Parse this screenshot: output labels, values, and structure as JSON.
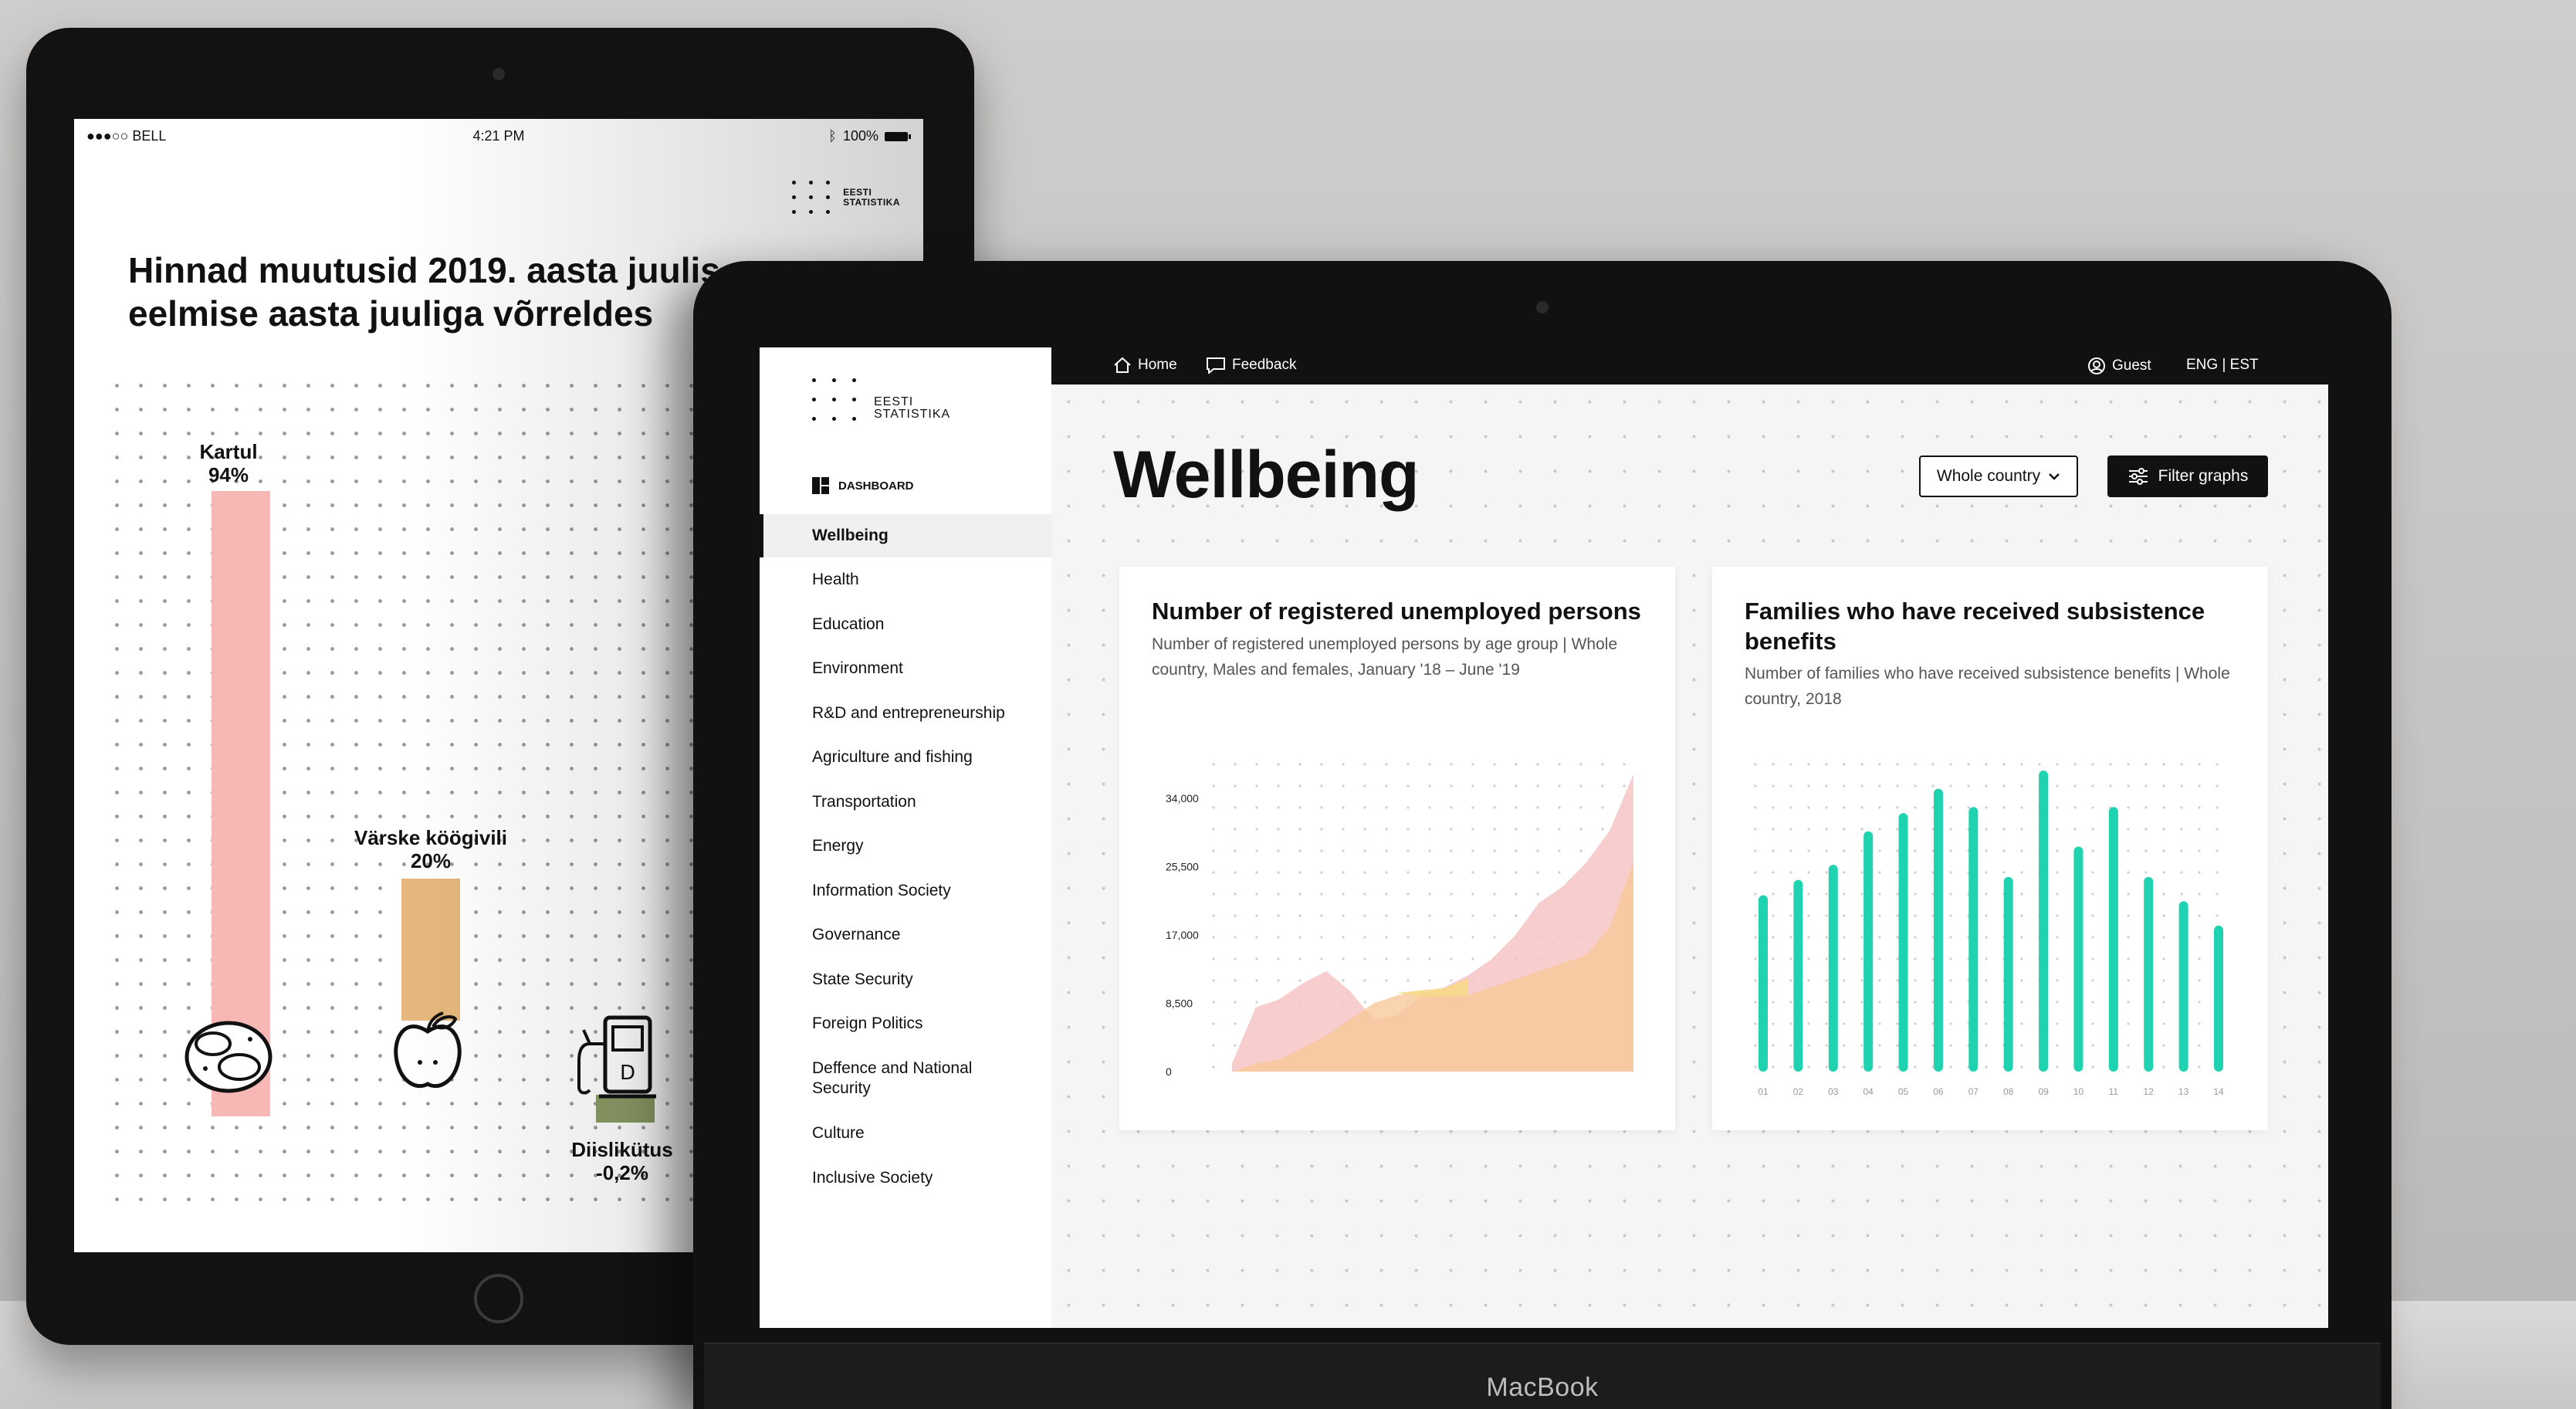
{
  "tablet": {
    "status": {
      "carrier": "●●●○○ BELL",
      "time": "4:21 PM",
      "battery": "100%"
    },
    "logo": {
      "line1": "EESTI",
      "line2": "STATISTIKA"
    },
    "title": "Hinnad muutusid 2019. aasta juulis eelmise aasta juuliga võrreldes",
    "bars": [
      {
        "name": "Kartul",
        "value_label": "94%",
        "value": 94,
        "color": "#f7b7b5",
        "icon": "potato-icon"
      },
      {
        "name": "Värske köögivili",
        "value_label": "20%",
        "value": 20,
        "color": "#e6b87d",
        "icon": "apple-icon"
      },
      {
        "name": "Diislikütus",
        "value_label": "-0,2%",
        "value": -0.2,
        "color": "#8a9a64",
        "icon": "fuel-pump-icon"
      }
    ]
  },
  "laptop": {
    "brand": "MacBook",
    "topbar": {
      "home": "Home",
      "feedback": "Feedback",
      "guest": "Guest",
      "lang": "ENG | EST"
    },
    "logo": {
      "line1": "EESTI",
      "line2": "STATISTIKA"
    },
    "dashboard_label": "DASHBOARD",
    "nav": [
      "Wellbeing",
      "Health",
      "Education",
      "Environment",
      "R&D and entrepreneurship",
      "Agriculture and fishing",
      "Transportation",
      "Energy",
      "Information Society",
      "Governance",
      "State Security",
      "Foreign Politics",
      "Deffence and National Security",
      "Culture",
      "Inclusive Society"
    ],
    "active_nav": "Wellbeing",
    "page_title": "Wellbeing",
    "region_select": "Whole country",
    "filter_button": "Filter graphs",
    "colors": {
      "pink": "#f6c4c4",
      "orange": "#f8c99a",
      "yellow": "#f6d987",
      "teal": "#1fd3b0"
    }
  },
  "chart_data": [
    {
      "type": "area",
      "title": "Number of registered unemployed persons",
      "subtitle": "Number of registered unemployed persons by age group | Whole country, Males and females, January '18 – June '19",
      "y_ticks": [
        "34,000",
        "25,500",
        "17,000",
        "8,500",
        "0"
      ],
      "ylim": [
        0,
        34000
      ],
      "x": [
        0,
        1,
        2,
        3,
        4,
        5,
        6,
        7,
        8,
        9,
        10,
        11,
        12,
        13,
        14,
        15,
        16,
        17
      ],
      "series": [
        {
          "values": [
            1000,
            8000,
            9000,
            11000,
            12500,
            10000,
            6500,
            7000,
            9500,
            10500,
            12000,
            14000,
            17000,
            21000,
            23000,
            26000,
            30000,
            37000
          ]
        },
        {
          "values": [
            0,
            1000,
            1500,
            3000,
            4500,
            6500,
            8500,
            9500,
            10000,
            9500,
            9500,
            10500,
            11500,
            12500,
            13500,
            14500,
            18000,
            26000
          ]
        }
      ]
    },
    {
      "type": "bar",
      "title": "Families who have received subsistence benefits",
      "subtitle": "Number of families who have received subsistence benefits | Whole country, 2018",
      "categories": [
        "01",
        "02",
        "03",
        "04",
        "05",
        "06",
        "07",
        "08",
        "09",
        "10",
        "11",
        "12",
        "13",
        "14"
      ],
      "values": [
        58,
        63,
        68,
        79,
        85,
        93,
        87,
        64,
        99,
        74,
        87,
        64,
        56,
        48
      ],
      "ylim": [
        0,
        100
      ]
    }
  ]
}
